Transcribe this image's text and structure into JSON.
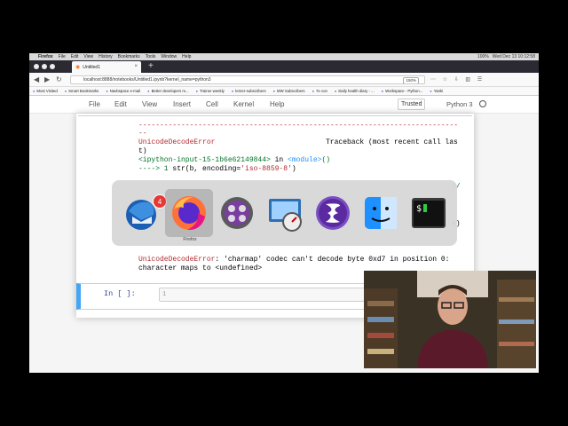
{
  "macos_menubar": {
    "app": "Firefox",
    "items": [
      "File",
      "Edit",
      "View",
      "History",
      "Bookmarks",
      "Tools",
      "Window",
      "Help"
    ],
    "clock": "Wed Dec 13 10:12:58",
    "battery": "100%"
  },
  "browser": {
    "tab_title": "Untitled1",
    "tab_close": "×",
    "new_tab": "+",
    "url": "localhost:8888/notebooks/Untitled1.ipynb?kernel_name=python3",
    "zoom": "150%",
    "bookmarks": [
      "Most Visited",
      "Smart Bookmarks",
      "Navbspace e-mail",
      "Better developers m...",
      "Trainer weekly",
      "lerner-subscribers",
      "MW Subscribers",
      "7e con",
      "Daily health diary - ...",
      "Workspace - Python...",
      "Yanki"
    ]
  },
  "jupyter": {
    "menu": [
      "File",
      "Edit",
      "View",
      "Insert",
      "Cell",
      "Kernel",
      "Help"
    ],
    "trusted": "Trusted",
    "kernel_name": "Python 3"
  },
  "output": {
    "dashes": "---------------------------------------------------------------------------",
    "dashes_tail": "--",
    "error_name": "UnicodeDecodeError",
    "traceback": "Traceback (most recent call las",
    "traceback_tail": "t)",
    "input_ref": "<ipython-input-15-1b6e62149844>",
    "in_word": " in ",
    "module": "<module>",
    "module_parens": "()",
    "arrow": "----> 1 ",
    "code": "str(b, encoding=",
    "code_string": "'iso-8859-8'",
    "code_close": ")",
    "hidden_edge_1": "6/",
    "hidden_edge_2": "e)",
    "error_name_2": "UnicodeDecodeError",
    "error_msg_1": ": 'charmap' codec can't decode byte 0xd7 in position 0:",
    "error_msg_2": "character maps to <undefined>"
  },
  "cell": {
    "prompt": "In [ ]:",
    "line_number": "1"
  },
  "app_switcher": {
    "selected_label": "Firefox",
    "thunderbird_badge": "4",
    "apps": [
      "thunderbird-icon",
      "firefox-icon",
      "imovie-icon",
      "disk-utility-icon",
      "emacs-icon",
      "finder-icon",
      "terminal-icon"
    ]
  }
}
